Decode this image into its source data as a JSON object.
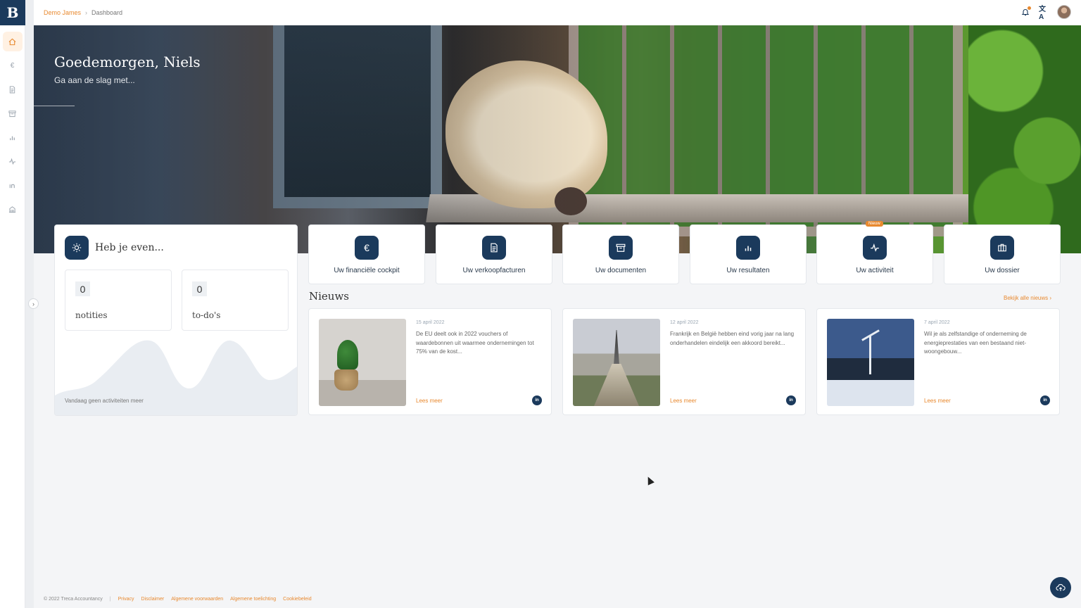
{
  "app": {
    "logo_letter": "B",
    "brand_color": "#1b3a5c",
    "accent_color": "#e8892f"
  },
  "breadcrumb": {
    "client": "Demo James",
    "page": "Dashboard"
  },
  "sidebar": {
    "items": [
      {
        "icon": "home-icon",
        "active": true
      },
      {
        "icon": "euro-icon",
        "active": false
      },
      {
        "icon": "document-icon",
        "active": false
      },
      {
        "icon": "archive-icon",
        "active": false
      },
      {
        "icon": "bar-chart-icon",
        "active": false
      },
      {
        "icon": "activity-icon",
        "active": false
      },
      {
        "icon": "linkedin-icon",
        "active": false
      },
      {
        "icon": "building-icon",
        "active": false
      }
    ]
  },
  "hero": {
    "greeting": "Goedemorgen, Niels",
    "subtitle": "Ga aan de slag met..."
  },
  "even_card": {
    "title": "Heb je even...",
    "notes_count": "0",
    "notes_label": "notities",
    "todos_count": "0",
    "todos_label": "to-do's",
    "empty_activity": "Vandaag geen activiteiten meer"
  },
  "tiles": [
    {
      "label": "Uw financiële cockpit",
      "icon": "euro-icon"
    },
    {
      "label": "Uw verkoopfacturen",
      "icon": "document-icon"
    },
    {
      "label": "Uw documenten",
      "icon": "archive-icon"
    },
    {
      "label": "Uw resultaten",
      "icon": "bar-chart-icon"
    },
    {
      "label": "Uw activiteit",
      "icon": "activity-icon",
      "badge": "Nieuw"
    },
    {
      "label": "Uw dossier",
      "icon": "briefcase-icon"
    }
  ],
  "news": {
    "title": "Nieuws",
    "view_all": "Bekijk alle nieuws",
    "items": [
      {
        "date": "15 april 2022",
        "text": "De EU deelt ook in 2022 vouchers of waardebonnen uit waarmee ondernemingen tot 75% van de kost...",
        "more": "Lees meer",
        "image": "plant-in-jar"
      },
      {
        "date": "12 april 2022",
        "text": "Frankrijk en België hebben eind vorig jaar na lang onderhandelen eindelijk een akkoord bereikt...",
        "more": "Lees meer",
        "image": "paris-eiffel-tower"
      },
      {
        "date": "7 april 2022",
        "text": "Wil je als zelfstandige of onderneming de energieprestaties van een bestaand niet-woongebouw...",
        "more": "Lees meer",
        "image": "solar-panels-wind-turbine"
      }
    ]
  },
  "footer": {
    "copyright": "© 2022 Treca Accountancy",
    "links": [
      "Privacy",
      "Disclaimer",
      "Algemene voorwaarden",
      "Algemene toelichting",
      "Cookiebeleid"
    ]
  }
}
